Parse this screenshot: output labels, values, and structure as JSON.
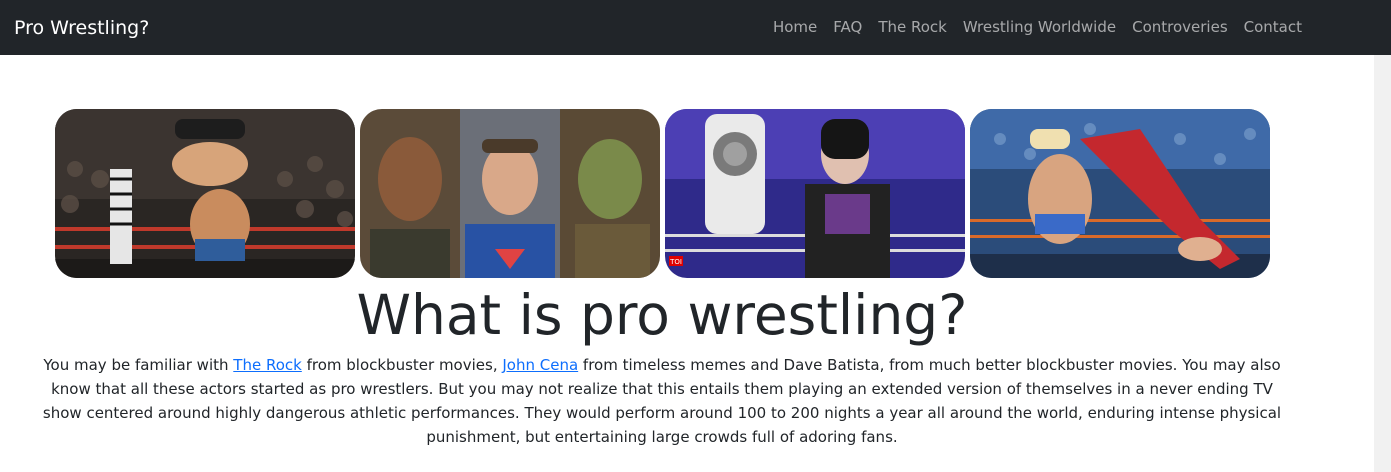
{
  "navbar": {
    "brand": "Pro Wrestling?",
    "links": [
      "Home",
      "FAQ",
      "The Rock",
      "Wrestling Worldwide",
      "Controveries",
      "Contact"
    ]
  },
  "gallery": {
    "images": [
      {
        "name": "wrestling-slam-photo"
      },
      {
        "name": "actors-collage-photo"
      },
      {
        "name": "champion-belt-photo"
      },
      {
        "name": "ring-kick-photo",
        "logo": ""
      }
    ],
    "logo_text": "TOI"
  },
  "main": {
    "heading": "What is pro wrestling?",
    "intro": {
      "pre_rock": "You may be familiar with ",
      "rock_link": "The Rock",
      "mid_cena": " from blockbuster movies, ",
      "cena_link": "John Cena",
      "rest": " from timeless memes and Dave Batista, from much better blockbuster movies. You may also know that all these actors started as pro wrestlers. But you may not realize that this entails them playing an extended version of themselves in a never ending TV show centered around highly dangerous athletic performances. They would perform around 100 to 200 nights a year all around the world, enduring intense physical punishment, but entertaining large crowds full of adoring fans."
    }
  },
  "colors": {
    "navbar_bg": "#212529",
    "link": "#0d6efd",
    "text": "#212529"
  }
}
